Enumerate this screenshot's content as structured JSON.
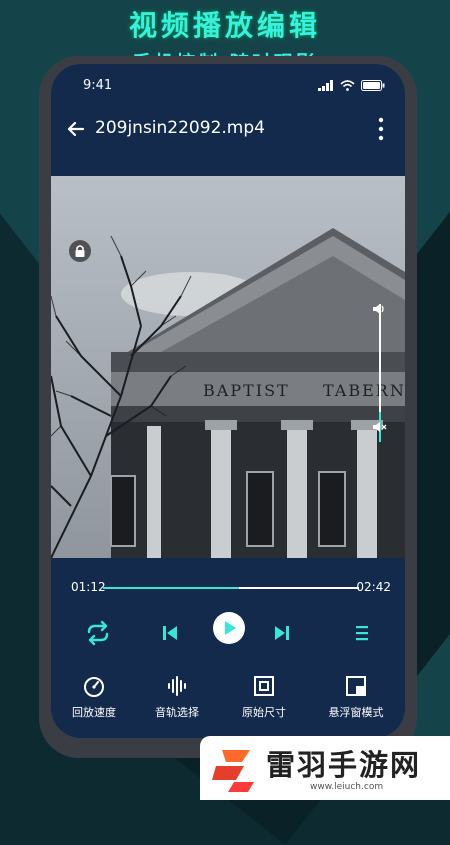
{
  "promo": {
    "title": "视频播放编辑",
    "subtitle": "手机控制 随时观影"
  },
  "status_bar": {
    "time": "9:41"
  },
  "header": {
    "filename": "209jnsin22092.mp4"
  },
  "video": {
    "building_sign_left": "BAPTIST",
    "building_sign_right": "TABERNA"
  },
  "playback": {
    "current_time": "01:12",
    "total_time": "02:42",
    "progress_fraction": 0.53,
    "volume_fraction": 0.78
  },
  "tools": [
    {
      "label": "回放速度",
      "icon": "speed-gauge-icon"
    },
    {
      "label": "音轨选择",
      "icon": "audio-wave-icon"
    },
    {
      "label": "原始尺寸",
      "icon": "original-size-icon"
    },
    {
      "label": "悬浮窗模式",
      "icon": "floating-window-icon"
    }
  ],
  "watermark": {
    "text": "雷羽手游网",
    "url": "www.leiuch.com"
  },
  "colors": {
    "accent": "#37e6d7",
    "screen_bg": "#132a4c",
    "page_bg": "#0d2a31"
  }
}
